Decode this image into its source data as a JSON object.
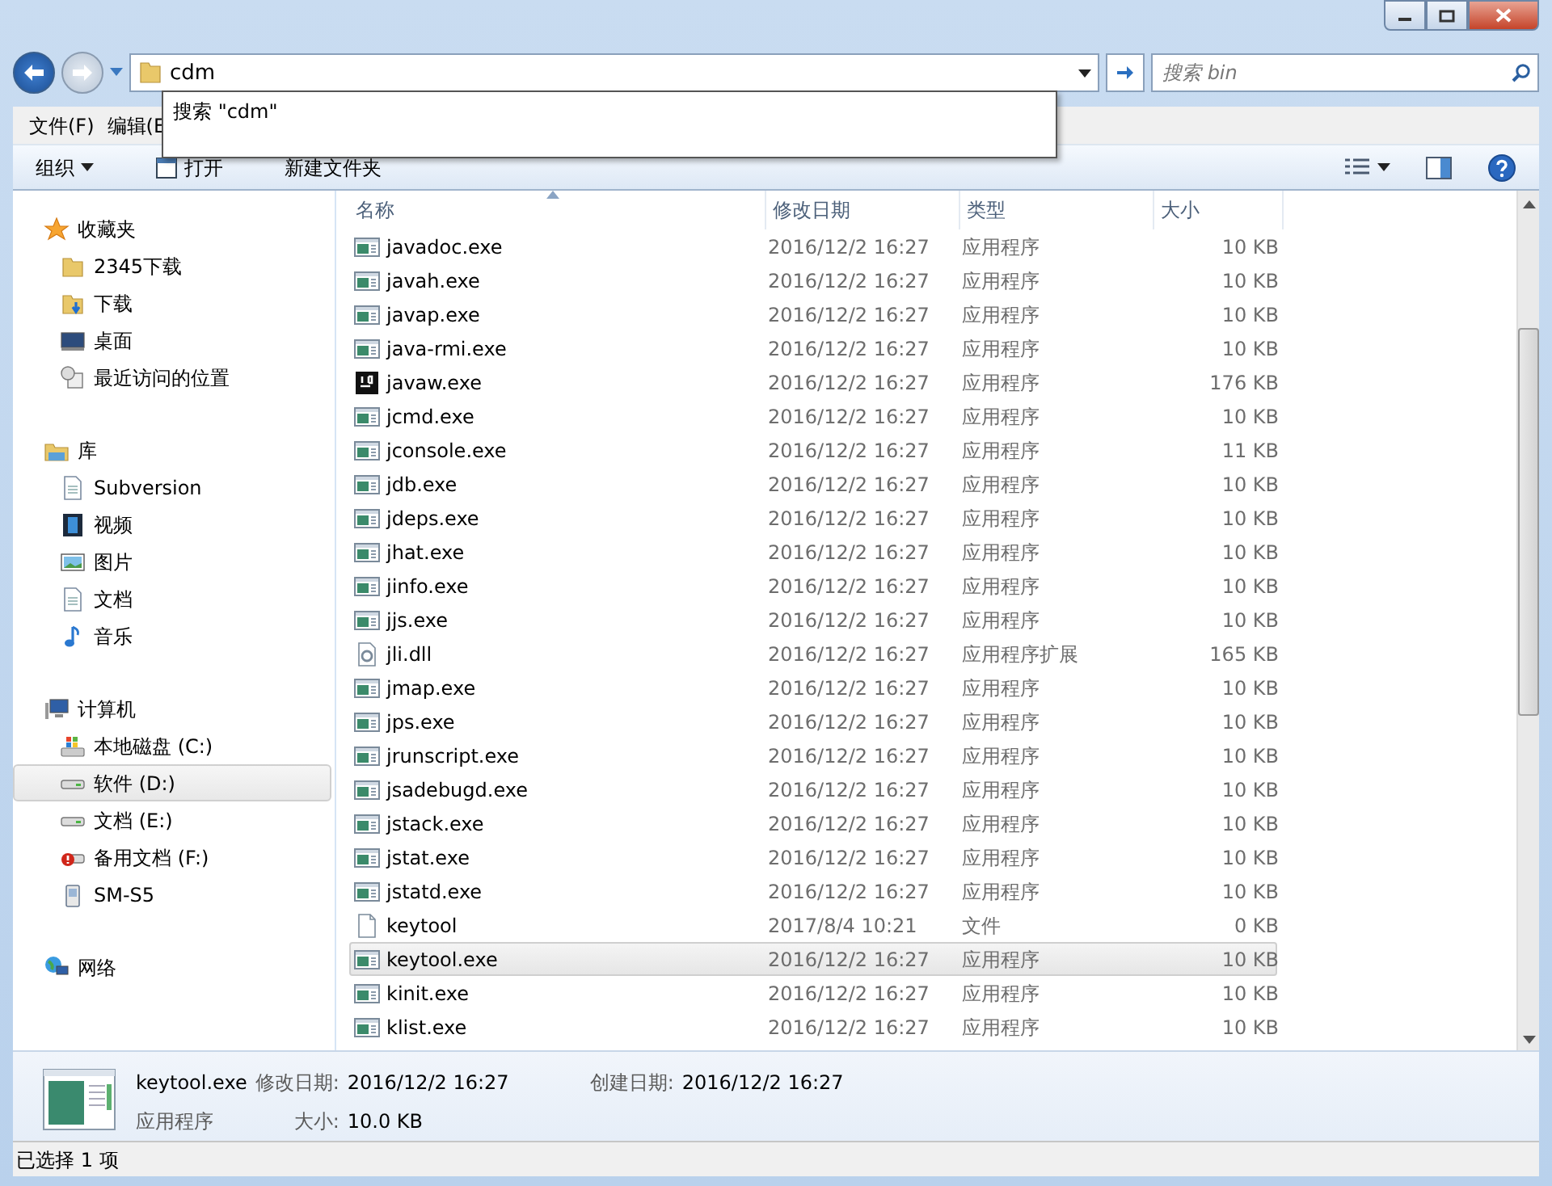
{
  "address": {
    "value": "cdm",
    "suggestion": "搜索 \"cdm\""
  },
  "search": {
    "placeholder": "搜索 bin"
  },
  "menu": [
    "文件(F)",
    "编辑(E"
  ],
  "toolbar": [
    {
      "label": "组织",
      "kind": "dropdown"
    },
    {
      "label": "打开",
      "kind": "open"
    },
    {
      "label": "新建文件夹",
      "kind": "plain"
    }
  ],
  "sidebar": [
    {
      "label": "收藏夹",
      "kind": "star",
      "children": [
        {
          "label": "2345下载",
          "kind": "folder",
          "selected": false
        },
        {
          "label": "下载",
          "kind": "download",
          "selected": false
        },
        {
          "label": "桌面",
          "kind": "desktop",
          "selected": false
        },
        {
          "label": "最近访问的位置",
          "kind": "recent",
          "selected": false
        }
      ]
    },
    {
      "label": "库",
      "kind": "library",
      "children": [
        {
          "label": "Subversion",
          "kind": "document",
          "selected": false
        },
        {
          "label": "视频",
          "kind": "video",
          "selected": false
        },
        {
          "label": "图片",
          "kind": "picture",
          "selected": false
        },
        {
          "label": "文档",
          "kind": "document",
          "selected": false
        },
        {
          "label": "音乐",
          "kind": "music",
          "selected": false
        }
      ]
    },
    {
      "label": "计算机",
      "kind": "computer",
      "children": [
        {
          "label": "本地磁盘 (C:)",
          "kind": "windisk",
          "selected": false
        },
        {
          "label": "软件 (D:)",
          "kind": "drive",
          "selected": true
        },
        {
          "label": "文档 (E:)",
          "kind": "drive",
          "selected": false
        },
        {
          "label": "备用文档 (F:)",
          "kind": "drivewarn",
          "selected": false
        },
        {
          "label": "SM-S5",
          "kind": "phone",
          "selected": false
        }
      ]
    },
    {
      "label": "网络",
      "kind": "network"
    }
  ],
  "columns": [
    "名称",
    "修改日期",
    "类型",
    "大小"
  ],
  "files": [
    {
      "name": "javadoc.exe",
      "date": "2016/12/2 16:27",
      "type": "应用程序",
      "size": "10 KB",
      "kind": "exe",
      "selected": false
    },
    {
      "name": "javah.exe",
      "date": "2016/12/2 16:27",
      "type": "应用程序",
      "size": "10 KB",
      "kind": "exe",
      "selected": false
    },
    {
      "name": "javap.exe",
      "date": "2016/12/2 16:27",
      "type": "应用程序",
      "size": "10 KB",
      "kind": "exe",
      "selected": false
    },
    {
      "name": "java-rmi.exe",
      "date": "2016/12/2 16:27",
      "type": "应用程序",
      "size": "10 KB",
      "kind": "exe",
      "selected": false
    },
    {
      "name": "javaw.exe",
      "date": "2016/12/2 16:27",
      "type": "应用程序",
      "size": "176 KB",
      "kind": "jb",
      "selected": false
    },
    {
      "name": "jcmd.exe",
      "date": "2016/12/2 16:27",
      "type": "应用程序",
      "size": "10 KB",
      "kind": "exe",
      "selected": false
    },
    {
      "name": "jconsole.exe",
      "date": "2016/12/2 16:27",
      "type": "应用程序",
      "size": "11 KB",
      "kind": "exe",
      "selected": false
    },
    {
      "name": "jdb.exe",
      "date": "2016/12/2 16:27",
      "type": "应用程序",
      "size": "10 KB",
      "kind": "exe",
      "selected": false
    },
    {
      "name": "jdeps.exe",
      "date": "2016/12/2 16:27",
      "type": "应用程序",
      "size": "10 KB",
      "kind": "exe",
      "selected": false
    },
    {
      "name": "jhat.exe",
      "date": "2016/12/2 16:27",
      "type": "应用程序",
      "size": "10 KB",
      "kind": "exe",
      "selected": false
    },
    {
      "name": "jinfo.exe",
      "date": "2016/12/2 16:27",
      "type": "应用程序",
      "size": "10 KB",
      "kind": "exe",
      "selected": false
    },
    {
      "name": "jjs.exe",
      "date": "2016/12/2 16:27",
      "type": "应用程序",
      "size": "10 KB",
      "kind": "exe",
      "selected": false
    },
    {
      "name": "jli.dll",
      "date": "2016/12/2 16:27",
      "type": "应用程序扩展",
      "size": "165 KB",
      "kind": "dll",
      "selected": false
    },
    {
      "name": "jmap.exe",
      "date": "2016/12/2 16:27",
      "type": "应用程序",
      "size": "10 KB",
      "kind": "exe",
      "selected": false
    },
    {
      "name": "jps.exe",
      "date": "2016/12/2 16:27",
      "type": "应用程序",
      "size": "10 KB",
      "kind": "exe",
      "selected": false
    },
    {
      "name": "jrunscript.exe",
      "date": "2016/12/2 16:27",
      "type": "应用程序",
      "size": "10 KB",
      "kind": "exe",
      "selected": false
    },
    {
      "name": "jsadebugd.exe",
      "date": "2016/12/2 16:27",
      "type": "应用程序",
      "size": "10 KB",
      "kind": "exe",
      "selected": false
    },
    {
      "name": "jstack.exe",
      "date": "2016/12/2 16:27",
      "type": "应用程序",
      "size": "10 KB",
      "kind": "exe",
      "selected": false
    },
    {
      "name": "jstat.exe",
      "date": "2016/12/2 16:27",
      "type": "应用程序",
      "size": "10 KB",
      "kind": "exe",
      "selected": false
    },
    {
      "name": "jstatd.exe",
      "date": "2016/12/2 16:27",
      "type": "应用程序",
      "size": "10 KB",
      "kind": "exe",
      "selected": false
    },
    {
      "name": "keytool",
      "date": "2017/8/4 10:21",
      "type": "文件",
      "size": "0 KB",
      "kind": "file",
      "selected": false
    },
    {
      "name": "keytool.exe",
      "date": "2016/12/2 16:27",
      "type": "应用程序",
      "size": "10 KB",
      "kind": "exe",
      "selected": true
    },
    {
      "name": "kinit.exe",
      "date": "2016/12/2 16:27",
      "type": "应用程序",
      "size": "10 KB",
      "kind": "exe",
      "selected": false
    },
    {
      "name": "klist.exe",
      "date": "2016/12/2 16:27",
      "type": "应用程序",
      "size": "10 KB",
      "kind": "exe",
      "selected": false
    }
  ],
  "details": {
    "name": "keytool.exe",
    "type": "应用程序",
    "modified_label": "修改日期:",
    "modified": "2016/12/2 16:27",
    "created_label": "创建日期:",
    "created": "2016/12/2 16:27",
    "size_label": "大小:",
    "size": "10.0 KB"
  },
  "status_bar": "已选择 1 项"
}
